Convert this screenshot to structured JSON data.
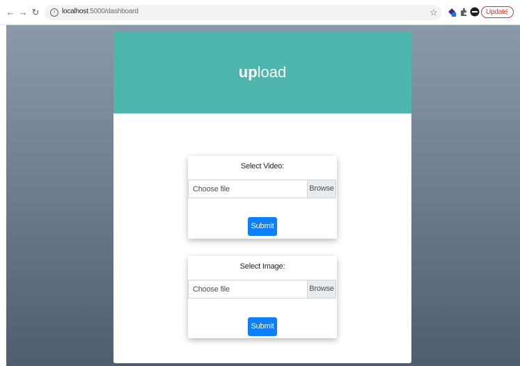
{
  "browser": {
    "url_host": "localhost",
    "url_rest": ":5000/dashboard",
    "update_label": "Update",
    "update_more": "⋮"
  },
  "icons": {
    "back": "back-arrow-icon",
    "forward": "forward-arrow-icon",
    "reload": "reload-icon",
    "info": "info-icon",
    "star": "star-icon",
    "extension": "extension-icon",
    "puzzle": "puzzle-icon",
    "profile": "profile-icon"
  },
  "colors": {
    "header": "#4fb6ad",
    "submit": "#0d7ff7",
    "update": "#d93025"
  },
  "brand": {
    "bold": "up",
    "light": "load"
  },
  "video_form": {
    "title": "Select Video:",
    "file_label": "Choose file",
    "browse_label": "Browse",
    "submit_label": "Submit"
  },
  "image_form": {
    "title": "Select Image:",
    "file_label": "Choose file",
    "browse_label": "Browse",
    "submit_label": "Submit"
  }
}
